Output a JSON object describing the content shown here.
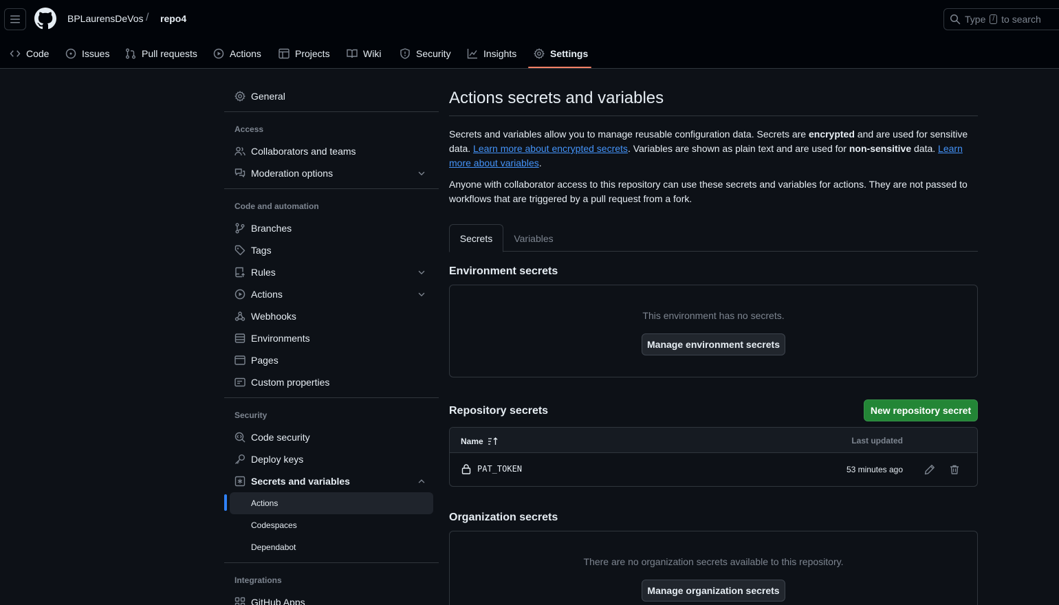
{
  "header": {
    "owner": "BPLaurensDeVos",
    "separator": "/",
    "repo": "repo4",
    "search_before": "Type",
    "search_key": "/",
    "search_after": "to search"
  },
  "repo_nav": {
    "tabs": [
      {
        "label": "Code",
        "icon": "code-icon"
      },
      {
        "label": "Issues",
        "icon": "issue-icon"
      },
      {
        "label": "Pull requests",
        "icon": "pull-request-icon"
      },
      {
        "label": "Actions",
        "icon": "play-icon"
      },
      {
        "label": "Projects",
        "icon": "table-icon"
      },
      {
        "label": "Wiki",
        "icon": "book-icon"
      },
      {
        "label": "Security",
        "icon": "shield-icon"
      },
      {
        "label": "Insights",
        "icon": "graph-icon"
      },
      {
        "label": "Settings",
        "icon": "gear-icon",
        "active": true
      }
    ],
    "accent_color": "#f78166"
  },
  "sidebar": {
    "general": "General",
    "access_heading": "Access",
    "collaborators": "Collaborators and teams",
    "moderation": "Moderation options",
    "code_heading": "Code and automation",
    "branches": "Branches",
    "tags": "Tags",
    "rules": "Rules",
    "actions": "Actions",
    "webhooks": "Webhooks",
    "environments": "Environments",
    "pages": "Pages",
    "custom_properties": "Custom properties",
    "security_heading": "Security",
    "code_security": "Code security",
    "deploy_keys": "Deploy keys",
    "secrets_and_variables": "Secrets and variables",
    "sub_actions": "Actions",
    "sub_codespaces": "Codespaces",
    "sub_dependabot": "Dependabot",
    "integrations_heading": "Integrations",
    "github_apps": "GitHub Apps"
  },
  "main": {
    "title": "Actions secrets and variables",
    "desc_part1": "Secrets and variables allow you to manage reusable configuration data. Secrets are ",
    "desc_bold1": "encrypted",
    "desc_part2": " and are used for sensitive data. ",
    "desc_link1": "Learn more about encrypted secrets",
    "desc_part3": ". Variables are shown as plain text and are used for ",
    "desc_bold2": "non-sensitive",
    "desc_part4": " data. ",
    "desc_link2": "Learn more about variables",
    "desc_part5": ".",
    "desc2": "Anyone with collaborator access to this repository can use these secrets and variables for actions. They are not passed to workflows that are triggered by a pull request from a fork.",
    "tab_secrets": "Secrets",
    "tab_variables": "Variables",
    "env_title": "Environment secrets",
    "env_empty": "This environment has no secrets.",
    "env_button": "Manage environment secrets",
    "repo_title": "Repository secrets",
    "new_secret_button": "New repository secret",
    "col_name": "Name",
    "col_updated": "Last updated",
    "secrets": [
      {
        "name": "PAT_TOKEN",
        "updated": "53 minutes ago"
      }
    ],
    "org_title": "Organization secrets",
    "org_empty": "There are no organization secrets available to this repository.",
    "org_button": "Manage organization secrets"
  }
}
